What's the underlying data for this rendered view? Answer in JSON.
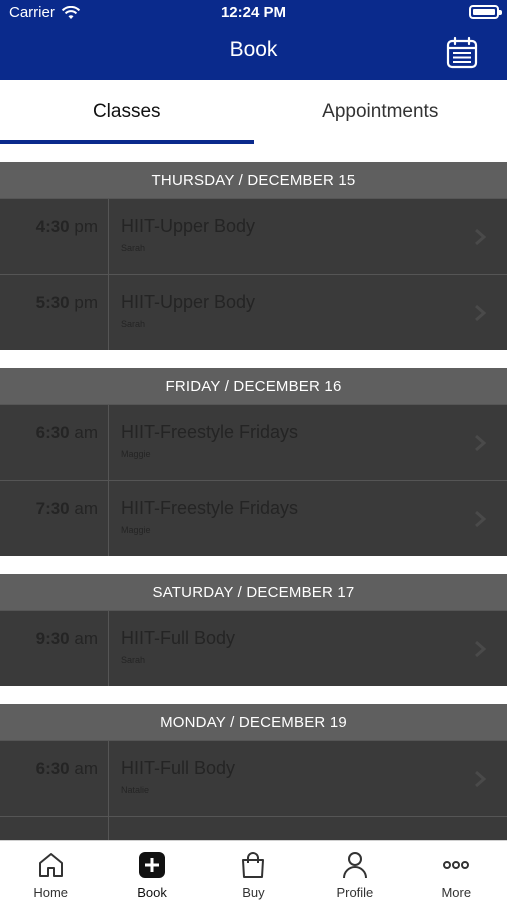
{
  "status_bar": {
    "carrier": "Carrier",
    "time": "12:24 PM"
  },
  "nav": {
    "title": "Book"
  },
  "tabs": [
    {
      "label": "Classes",
      "active": true
    },
    {
      "label": "Appointments",
      "active": false
    }
  ],
  "sections": [
    {
      "header": "THURSDAY / DECEMBER 15",
      "rows": [
        {
          "time": "4:30",
          "ampm": "pm",
          "name": "HIIT-Upper Body",
          "instructor": "Sarah"
        },
        {
          "time": "5:30",
          "ampm": "pm",
          "name": "HIIT-Upper Body",
          "instructor": "Sarah"
        }
      ]
    },
    {
      "header": "FRIDAY / DECEMBER 16",
      "rows": [
        {
          "time": "6:30",
          "ampm": "am",
          "name": "HIIT-Freestyle Fridays",
          "instructor": "Maggie"
        },
        {
          "time": "7:30",
          "ampm": "am",
          "name": "HIIT-Freestyle Fridays",
          "instructor": "Maggie"
        }
      ]
    },
    {
      "header": "SATURDAY / DECEMBER 17",
      "rows": [
        {
          "time": "9:30",
          "ampm": "am",
          "name": "HIIT-Full Body",
          "instructor": "Sarah"
        }
      ]
    },
    {
      "header": "MONDAY / DECEMBER 19",
      "rows": [
        {
          "time": "6:30",
          "ampm": "am",
          "name": "HIIT-Full Body",
          "instructor": "Natalie"
        },
        {
          "time": "",
          "ampm": "",
          "name": "",
          "instructor": ""
        }
      ]
    }
  ],
  "bottom_tabs": [
    {
      "label": "Home",
      "icon": "home-icon"
    },
    {
      "label": "Book",
      "icon": "plus-square-icon",
      "active": true
    },
    {
      "label": "Buy",
      "icon": "shopping-bag-icon"
    },
    {
      "label": "Profile",
      "icon": "person-icon"
    },
    {
      "label": "More",
      "icon": "more-dots-icon"
    }
  ],
  "colors": {
    "brand": "#0a2a8c",
    "section_header": "#5f5f5f",
    "row_bg": "#3a3a3a"
  }
}
